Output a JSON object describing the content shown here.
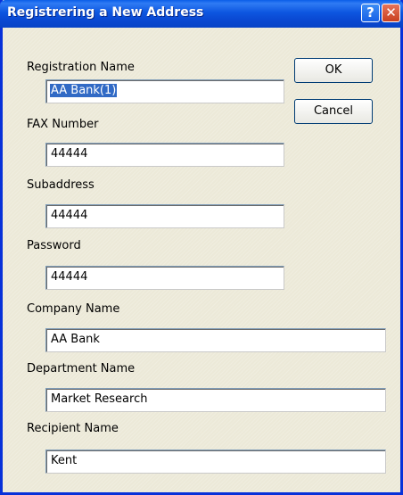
{
  "window": {
    "title": "Registrering a New Address",
    "help_glyph": "?",
    "close_glyph": "✕"
  },
  "buttons": {
    "ok": "OK",
    "cancel": "Cancel"
  },
  "fields": {
    "registration_name": {
      "label": "Registration Name",
      "value": "AA Bank(1)"
    },
    "fax_number": {
      "label": "FAX Number",
      "value": "44444"
    },
    "subaddress": {
      "label": "Subaddress",
      "value": "44444"
    },
    "password": {
      "label": "Password",
      "value": "44444"
    },
    "company_name": {
      "label": "Company Name",
      "value": "AA Bank"
    },
    "department_name": {
      "label": "Department Name",
      "value": "Market Research"
    },
    "recipient_name": {
      "label": "Recipient Name",
      "value": "Kent"
    }
  },
  "colors": {
    "title_bar": "#0a49d3",
    "dialog_bg": "#ece9d8",
    "selection": "#316ac5",
    "close_button": "#c8401f"
  }
}
